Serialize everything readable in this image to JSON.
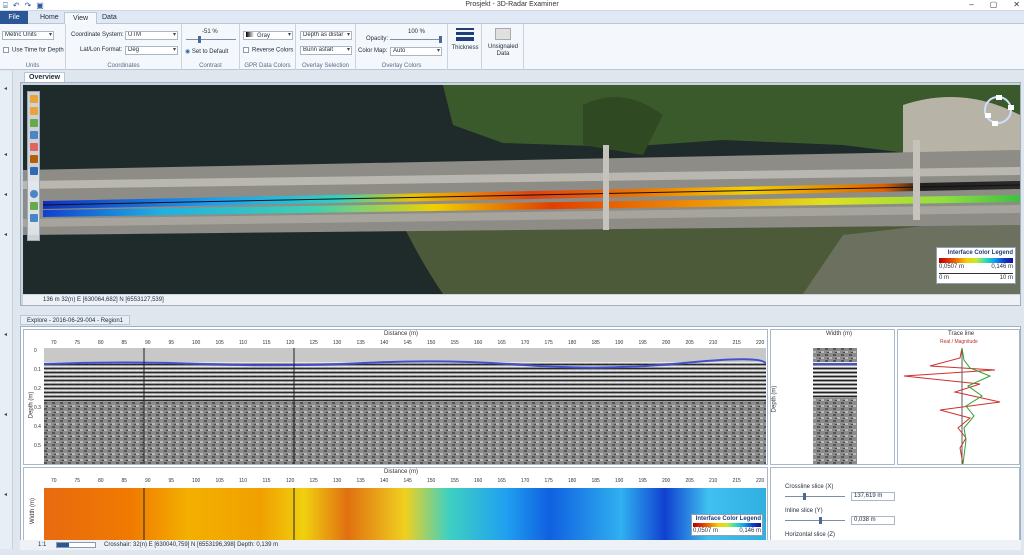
{
  "window": {
    "title": "Prosjekt - 3D-Radar Examiner"
  },
  "tabs": {
    "file": "File",
    "home": "Home",
    "view": "View",
    "data": "Data"
  },
  "units": {
    "select": "Metric Units",
    "use_time": "Use Time for Depth",
    "group": "Units"
  },
  "coordinates": {
    "system_label": "Coordinate System:",
    "system_value": "UTM",
    "format_label": "Lat/Lon Format:",
    "format_value": "Deg",
    "group": "Coordinates"
  },
  "contrast": {
    "value": "-51 %",
    "reset": "Set to Default",
    "group": "Contrast",
    "level": -0.51
  },
  "gpr_colors": {
    "palette": "Gray",
    "reverse": "Reverse Colors",
    "group": "GPR Data Colors"
  },
  "overlay_selection": {
    "mode": "Depth as distar",
    "surface": "Bunn asfalt",
    "group": "Overlay Selection"
  },
  "overlay_colors": {
    "opacity_label": "Opacity:",
    "opacity_value": "100 %",
    "colormap_label": "Color Map:",
    "colormap_value": "Auto",
    "group": "Overlay Colors",
    "opacity_level": 1.0
  },
  "thickness": {
    "label": "Thickness"
  },
  "unsignaled": {
    "label": "Unsignaled Data"
  },
  "overview": {
    "tab": "Overview",
    "status": "136 m   32(n) E [630064,682]  N [6553127,539]",
    "legend": {
      "title": "Interface Color Legend",
      "min": "0,0507 m",
      "max": "0,146 m",
      "scale_start": "0 m",
      "scale_end": "10 m"
    }
  },
  "explore": {
    "tab": "Explore - 2016-06-29-004 - Region1",
    "distance_label": "Distance (m)",
    "depth_label": "Depth (m)",
    "width_label": "Width (m)",
    "x_ticks": [
      "70",
      "75",
      "80",
      "85",
      "90",
      "95",
      "100",
      "105",
      "110",
      "115",
      "120",
      "125",
      "130",
      "135",
      "140",
      "145",
      "150",
      "155",
      "160",
      "165",
      "170",
      "175",
      "180",
      "185",
      "190",
      "195",
      "200",
      "205",
      "210",
      "215",
      "220"
    ],
    "depth_ticks": [
      "0",
      "0.1",
      "0.2",
      "0.3",
      "0.4",
      "0.5"
    ],
    "width_panel_title": "Width (m)",
    "trace_title": "Trace line",
    "trace_legend": "Real / Magnitude",
    "bottom_legend": {
      "title": "Interface Color Legend",
      "min": "0,0507 m",
      "max": "0,146 m"
    },
    "crossline_label": "Crossline slice (X)",
    "crossline_value": "137,619 m",
    "inline_label": "Inline slice (Y)",
    "inline_value": "0,038 m",
    "horizontal_label": "Horizontal slice (Z)"
  },
  "statusbar": {
    "zoom": "1:1",
    "crosshair": "Crosshair: 32(n) E [630040,759]  N [6553196,398]  Depth: 0,139 m"
  }
}
